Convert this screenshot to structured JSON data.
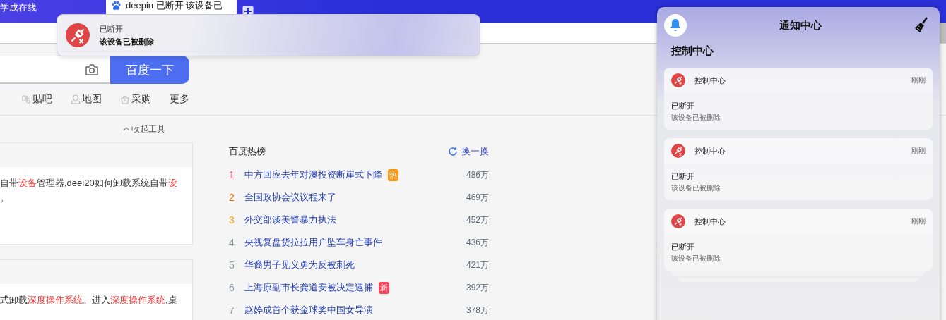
{
  "browser": {
    "tabs": [
      {
        "title": "学成在线",
        "selected": false
      },
      {
        "title": "deepin 已断开 该设备已",
        "selected": true
      }
    ]
  },
  "search": {
    "button": "百度一下"
  },
  "nav_links": [
    {
      "label": "贴吧",
      "kind": "tieba"
    },
    {
      "label": "地图",
      "kind": "map"
    },
    {
      "label": "采购",
      "kind": "shop"
    },
    {
      "label": "更多",
      "kind": "text"
    }
  ],
  "collapse_tools": "收起工具",
  "results": [
    {
      "lines": [
        [
          {
            "text": "自带",
            "highlight": false
          },
          {
            "text": "设备",
            "highlight": true
          },
          {
            "text": "管理器,deei20如何卸载系统自带",
            "highlight": false
          },
          {
            "text": "设",
            "highlight": true
          }
        ],
        [
          {
            "text": "。",
            "highlight": false
          }
        ]
      ]
    },
    {
      "lines": [
        [
          {
            "text": "式卸载",
            "highlight": false
          },
          {
            "text": "深度操作系统",
            "highlight": true
          },
          {
            "text": "。进入",
            "highlight": false
          },
          {
            "text": "深度操作系统",
            "highlight": true
          },
          {
            "text": ",桌",
            "highlight": false
          }
        ]
      ]
    }
  ],
  "hot_list": {
    "title": "百度热榜",
    "refresh": "换一换",
    "items": [
      {
        "rank": "1",
        "color": "#f5475a",
        "title": "中方回应去年对澳投资断崖式下降",
        "badge": {
          "text": "热",
          "color": "#ff9812"
        },
        "heat": "486万"
      },
      {
        "rank": "2",
        "color": "#ff6600",
        "title": "全国政协会议议程来了",
        "heat": "469万"
      },
      {
        "rank": "3",
        "color": "#faa90e",
        "title": "外交部谈美警暴力执法",
        "heat": "452万"
      },
      {
        "rank": "4",
        "color": "#9195a3",
        "title": "央视复盘货拉拉用户坠车身亡事件",
        "heat": "436万"
      },
      {
        "rank": "5",
        "color": "#9195a3",
        "title": "华裔男子见义勇为反被刺死",
        "heat": "421万"
      },
      {
        "rank": "6",
        "color": "#9195a3",
        "title": "上海原副市长龚道安被决定逮捕",
        "badge": {
          "text": "新",
          "color": "#ff455b"
        },
        "heat": "392万"
      },
      {
        "rank": "7",
        "color": "#9195a3",
        "title": "赵婷成首个获金球奖中国女导演",
        "heat": "378万"
      }
    ]
  },
  "toast": {
    "title": "已断开",
    "body": "该设备已被删除"
  },
  "notification_center": {
    "title": "通知中心",
    "group": "控制中心",
    "notifications": [
      {
        "app": "控制中心",
        "time": "刚刚",
        "title": "已断开",
        "body": "该设备已被删除"
      },
      {
        "app": "控制中心",
        "time": "刚刚",
        "title": "已断开",
        "body": "该设备已被删除"
      },
      {
        "app": "控制中心",
        "time": "刚刚",
        "title": "已断开",
        "body": "该设备已被删除"
      }
    ]
  }
}
